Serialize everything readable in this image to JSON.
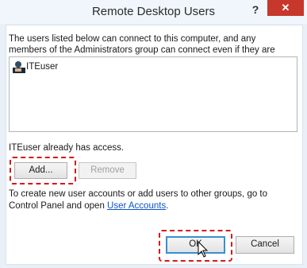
{
  "window": {
    "title": "Remote Desktop Users",
    "help_label": "?",
    "close_label": "✕"
  },
  "description": "The users listed below can connect to this computer, and any members of the Administrators group can connect even if they are not listed.",
  "users": [
    {
      "name": "ITEuser",
      "icon": "user-icon"
    }
  ],
  "access_text": "ITEuser already has access.",
  "buttons": {
    "add": "Add...",
    "remove": "Remove",
    "ok": "OK",
    "cancel": "Cancel"
  },
  "info": {
    "text": "To create new user accounts or add users to other groups, go to Control Panel and open ",
    "link": "User Accounts",
    "suffix": "."
  },
  "colors": {
    "highlight": "#d61919",
    "close": "#c7372c",
    "link": "#0a53c9"
  }
}
